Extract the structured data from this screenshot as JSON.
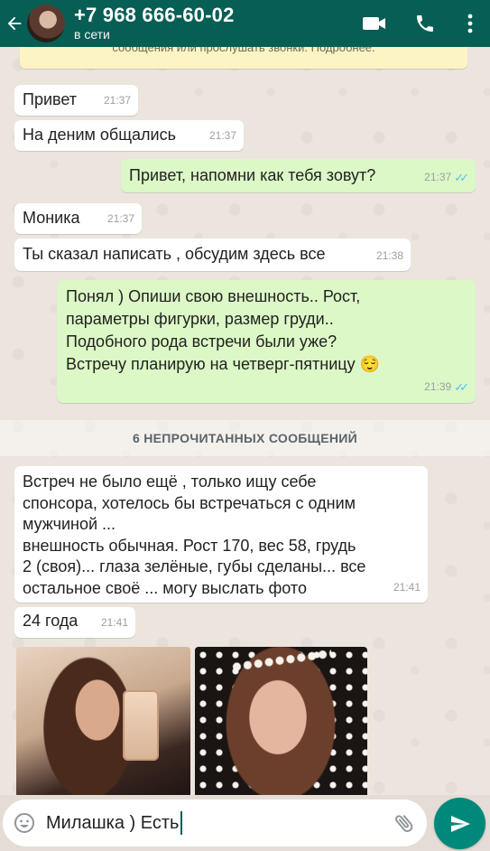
{
  "header": {
    "contact_name": "+7 968 666-60-02",
    "status": "в сети",
    "back_icon": "arrow-left-icon",
    "video_icon": "video-camera-icon",
    "call_icon": "phone-icon",
    "menu_icon": "more-vert-icon"
  },
  "notice": {
    "text": "сообщения или прослушать звонки. Подробнее."
  },
  "messages": [
    {
      "dir": "in",
      "text": "Привет",
      "time": "21:37"
    },
    {
      "dir": "in",
      "text": "На деним общались",
      "time": "21:37"
    },
    {
      "dir": "out",
      "text": "Привет, напомни как тебя зовут?",
      "time": "21:37",
      "status": "read"
    },
    {
      "dir": "in",
      "text": "Моника",
      "time": "21:37"
    },
    {
      "dir": "in",
      "text": "Ты сказал написать , обсудим здесь все",
      "time": "21:38"
    },
    {
      "dir": "out",
      "text": "Понял ) Опиши свою внешность.. Рост,\nпараметры фигурки, размер груди..\nПодобного рода встречи были уже?\nВстречу планирую на четверг-пятницу 😌",
      "time": "21:39",
      "status": "read"
    },
    {
      "dir": "in",
      "text": "Встреч не было ещё , только ищу себе\nспонсора, хотелось бы встречаться с одним\nмужчиной ...\nвнешность обычная. Рост 170, вес 58, грудь\n2 (своя)... глаза зелёные, губы сделаны... все\nостальное своё ... могу выслать фото",
      "time": "21:41"
    },
    {
      "dir": "in",
      "text": "24 года",
      "time": "21:41"
    }
  ],
  "unread_divider": "6 НЕПРОЧИТАННЫХ СООБЩЕНИЙ",
  "input": {
    "value": "Милашка ) Есть",
    "emoji_icon": "emoji-icon",
    "attach_icon": "paperclip-icon",
    "send_icon": "send-icon"
  },
  "colors": {
    "header": "#075e54",
    "outgoing_bubble": "#dcf8c6",
    "incoming_bubble": "#ffffff",
    "send_button": "#00897b",
    "read_ticks": "#4fc3f7"
  }
}
